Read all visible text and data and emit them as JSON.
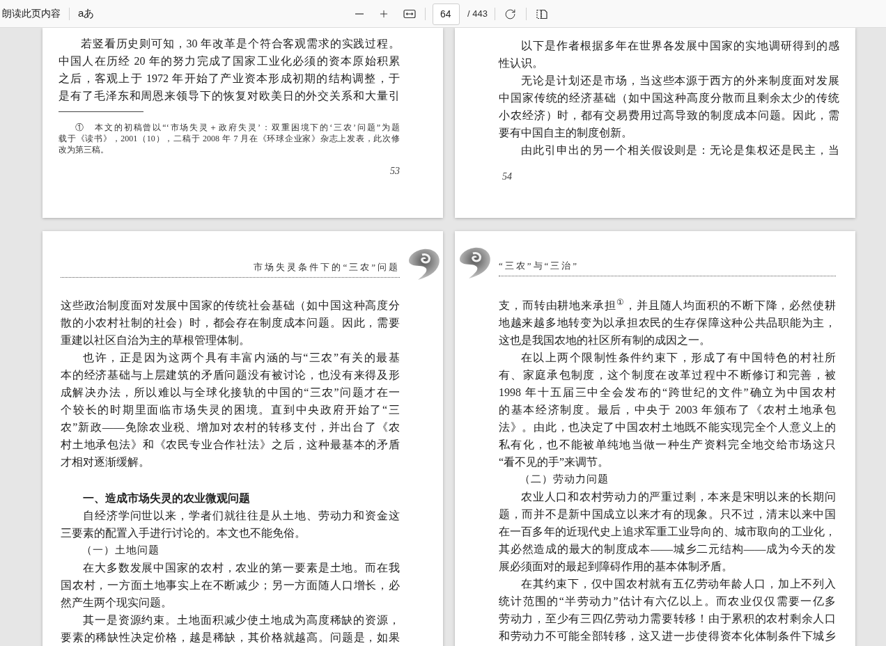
{
  "toolbar": {
    "read_aloud": "朗读此页内容",
    "text_options": "aあ",
    "page_input": "64",
    "page_total": "/ 443"
  },
  "pages": [
    {
      "blocks": [
        {
          "kind": "para",
          "indent": true,
          "continues": true,
          "lines": [
            "若竖看历史则可知，30 年改革是个符合客观需求的实践过程。",
            "中国人在历经 20 年的努力完成了国家工业化必须的资本原始积累",
            "之后，客观上于 1972 年开始了产业资本形成初期的结构调整，于",
            "是有了毛泽东和周恩来领导下的恢复对欧美日的外交关系和大量引"
          ]
        },
        {
          "kind": "footnote",
          "indent": true,
          "continues": false,
          "lines": [
            "①　本文的初稿曾以“‘市场失灵＋政府失灵’：双重困境下的‘三农’问题”为题",
            "载于《读书》，2001（10），二稿于 2008 年 7 月在《环球企业家》杂志上发表，此次修",
            "改为第三稿。"
          ]
        }
      ],
      "page_number": "53"
    },
    {
      "blocks": [
        {
          "kind": "para",
          "indent": true,
          "continues": false,
          "lines": [
            "以下是作者根据多年在世界各发展中国家的实地调研得到的感",
            "性认识。"
          ]
        },
        {
          "kind": "para",
          "indent": true,
          "continues": false,
          "lines": [
            "无论是计划还是市场，当这些本源于西方的外来制度面对发展",
            "中国家传统的经济基础（如中国这种高度分散而且剩余太少的传统",
            "小农经济）时，都有交易费用过高导致的制度成本问题。因此，需",
            "要有中国自主的制度创新。"
          ]
        },
        {
          "kind": "para",
          "indent": true,
          "continues": true,
          "lines": [
            "由此引申出的另一个相关假设则是：无论是集权还是民主，当"
          ]
        }
      ],
      "page_number": "54"
    },
    {
      "running_header": "市场失灵条件下的“三农”问题",
      "blocks": [
        {
          "kind": "para",
          "indent": false,
          "continues": false,
          "lines": [
            "这些政治制度面对发展中国家的传统社会基础（如中国这种高度分",
            "散的小农村社制的社会）时，都会存在制度成本问题。因此，需要",
            "重建以社区自治为主的草根管理体制。"
          ]
        },
        {
          "kind": "para",
          "indent": true,
          "continues": false,
          "lines": [
            "也许，正是因为这两个具有丰富内涵的与“三农”有关的最基",
            "本的经济基础与上层建筑的矛盾问题没有被讨论，也没有来得及形",
            "成解决办法，所以难以与全球化接轨的中国的“三农”问题才在一",
            "个较长的时期里面临市场失灵的困境。直到中央政府开始了“三",
            "农”新政——免除农业税、增加对农村的转移支付，并出台了《农",
            "村土地承包法》和《农民专业合作社法》之后，这种最基本的矛盾",
            "才相对逐渐缓解。"
          ]
        },
        {
          "kind": "heading",
          "text": "一、造成市场失灵的农业微观问题"
        },
        {
          "kind": "para",
          "indent": true,
          "continues": false,
          "lines": [
            "自经济学问世以来，学者们就往往是从土地、劳动力和资金这",
            "三要素的配置入手进行讨论的。本文也不能免俗。"
          ]
        },
        {
          "kind": "subheading",
          "text": "（一）土地问题"
        },
        {
          "kind": "para",
          "indent": true,
          "continues": false,
          "lines": [
            "在大多数发展中国家的农村，农业的第一要素是土地。而在我",
            "国农村，一方面土地事实上在不断减少；另一方面随人口增长，必",
            "然产生两个现实问题。"
          ]
        },
        {
          "kind": "para",
          "indent": true,
          "continues": true,
          "lines": [
            "其一是资源约束。土地面积减少使土地成为高度稀缺的资源，",
            "要素的稀缺性决定价格，越是稀缺，其价格就越高。问题是，如果"
          ]
        }
      ]
    },
    {
      "running_header": "“三农”与“三治”",
      "blocks": [
        {
          "kind": "para",
          "indent": false,
          "continues": false,
          "lines": [
            "支，而转由耕地来承担$^{①}$，并且随人均面积的不断下降，必然使耕",
            "地越来越多地转变为以承担农民的生存保障这种公共品职能为主，",
            "这也是我国农地的社区所有制的成因之一。"
          ]
        },
        {
          "kind": "para",
          "indent": true,
          "continues": false,
          "lines": [
            "在以上两个限制性条件约束下，形成了有中国特色的村社所",
            "有、家庭承包制度，这个制度在改革过程中不断修订和完善，被",
            "1998 年十五届三中全会发布的“跨世纪的文件”确立为中国农村",
            "的基本经济制度。最后，中央于 2003 年颁布了《农村土地承包",
            "法》。由此，也决定了中国农村土地既不能实现完全个人意义上的",
            "私有化，也不能被单纯地当做一种生产资料完全地交给市场这只",
            "“看不见的手”来调节。"
          ]
        },
        {
          "kind": "subheading",
          "text": "（二）劳动力问题"
        },
        {
          "kind": "para",
          "indent": true,
          "continues": false,
          "lines": [
            "农业人口和农村劳动力的严重过剩，本来是宋明以来的长期问",
            "题，而并不是新中国成立以来才有的现象。只不过，清末以来中国",
            "在一百多年的近现代史上追求军重工业导向的、城市取向的工业化，",
            "其必然造成的最大的制度成本——城乡二元结构——成为今天的发",
            "展必须面对的最起到障碍作用的基本体制矛盾。"
          ]
        },
        {
          "kind": "para",
          "indent": true,
          "continues": true,
          "lines": [
            "在其约束下，仅中国农村就有五亿劳动年龄人口，加上不列入",
            "统计范围的“半劳动力”估计有六亿以上。而农业仅仅需要一亿多",
            "劳动力，至少有三四亿劳动力需要转移！由于累积的农村剩余人口",
            "和劳动力不可能全部转移，这又进一步使得资本化体制条件下城乡"
          ]
        }
      ]
    }
  ]
}
